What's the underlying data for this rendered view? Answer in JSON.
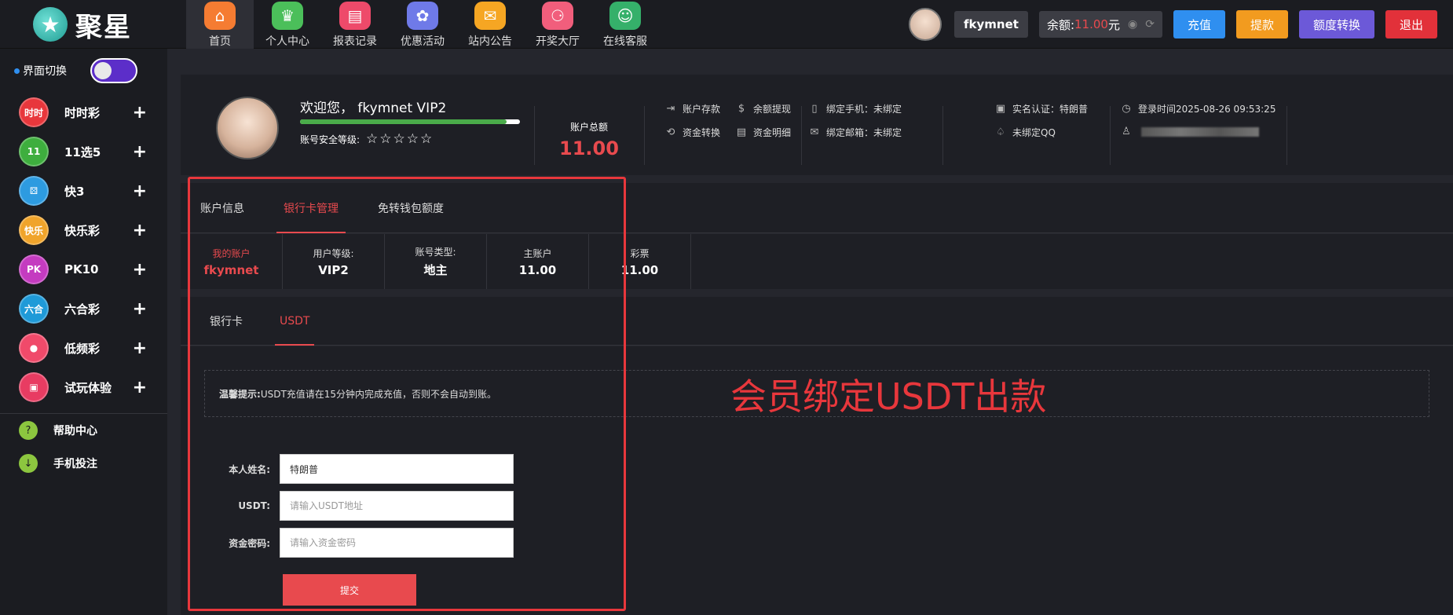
{
  "brand": {
    "name": "聚星",
    "logo_icon": "star-logo"
  },
  "nav": [
    {
      "label": "首页",
      "icon": "home-icon",
      "color": "#f57c32",
      "glyph": "⌂"
    },
    {
      "label": "个人中心",
      "icon": "crown-icon",
      "color": "#4bbf5a",
      "glyph": "♛"
    },
    {
      "label": "报表记录",
      "icon": "report-icon",
      "color": "#ee4a6a",
      "glyph": "▤"
    },
    {
      "label": "优惠活动",
      "icon": "gift-icon",
      "color": "#6f7ae8",
      "glyph": "✿"
    },
    {
      "label": "站内公告",
      "icon": "mail-icon",
      "color": "#f6a623",
      "glyph": "✉"
    },
    {
      "label": "开奖大厅",
      "icon": "lottery-icon",
      "color": "#f15e7c",
      "glyph": "⚆"
    },
    {
      "label": "在线客服",
      "icon": "support-icon",
      "color": "#35b06a",
      "glyph": "☺"
    }
  ],
  "topright": {
    "username": "fkymnet",
    "balance_label": "余额:",
    "balance_value": "11.00",
    "balance_unit": "元",
    "buttons": [
      "充值",
      "提款",
      "额度转换",
      "退出"
    ]
  },
  "sidebar": {
    "theme_label": "界面切换",
    "games": [
      {
        "label": "时时彩",
        "icon": "ssc-icon",
        "color": "#e8373c",
        "badge": "时时"
      },
      {
        "label": "11选5",
        "icon": "11x5-icon",
        "color": "#3eae3e",
        "badge": "11"
      },
      {
        "label": "快3",
        "icon": "k3-icon",
        "color": "#2d9be0",
        "badge": "⚄"
      },
      {
        "label": "快乐彩",
        "icon": "happy-icon",
        "color": "#f0a42b",
        "badge": "快乐"
      },
      {
        "label": "PK10",
        "icon": "pk10-icon",
        "color": "#c43bc0",
        "badge": "PK"
      },
      {
        "label": "六合彩",
        "icon": "lhc-icon",
        "color": "#1f9ad8",
        "badge": "六合"
      },
      {
        "label": "低频彩",
        "icon": "lowfreq-icon",
        "color": "#f04a6a",
        "badge": "●"
      },
      {
        "label": "试玩体验",
        "icon": "gamepad-icon",
        "color": "#e83c62",
        "badge": "▣"
      }
    ],
    "help": [
      {
        "label": "帮助中心",
        "icon": "help-icon",
        "glyph": "?"
      },
      {
        "label": "手机投注",
        "icon": "download-icon",
        "glyph": "↓"
      }
    ]
  },
  "profile": {
    "welcome": "欢迎您， fkymnet VIP2",
    "security_label": "账号安全等级:",
    "stars": "☆☆☆☆☆",
    "progress": 0.94,
    "total_label": "账户总额",
    "total_value": "11.00",
    "links": [
      {
        "label": "账户存款",
        "icon": "deposit-icon",
        "glyph": "⇥"
      },
      {
        "label": "余额提现",
        "icon": "moneybag-icon",
        "glyph": "$"
      },
      {
        "label": "资金转换",
        "icon": "transfer-icon",
        "glyph": "⟲"
      },
      {
        "label": "资金明细",
        "icon": "doc-icon",
        "glyph": "▤"
      }
    ],
    "binds": [
      {
        "label": "绑定手机：未绑定",
        "icon": "phone-icon",
        "glyph": "▯"
      },
      {
        "label": "绑定邮箱：未绑定",
        "icon": "email-icon",
        "glyph": "✉"
      },
      {
        "label": "实名认证：特朗普",
        "icon": "idcard-icon",
        "glyph": "▣"
      },
      {
        "label": "未绑定QQ",
        "icon": "qq-icon",
        "glyph": "♤"
      }
    ],
    "login_time": "登录时间2025-08-26 09:53:25"
  },
  "tabs": [
    "账户信息",
    "银行卡管理",
    "免转钱包额度"
  ],
  "info": [
    {
      "title": "我的账户",
      "value": "fkymnet"
    },
    {
      "title": "用户等级:",
      "value": "VIP2"
    },
    {
      "title": "账号类型:",
      "value": "地主"
    },
    {
      "title": "主账户",
      "value": "11.00"
    },
    {
      "title": "彩票",
      "value": "11.00"
    }
  ],
  "subtabs": [
    "银行卡",
    "USDT"
  ],
  "notice": {
    "bold": "温馨提示:",
    "text": " USDT充值请在15分钟内完成充值，否则不会自动到账。"
  },
  "annotation": "会员绑定USDT出款",
  "form": {
    "name_label": "本人姓名:",
    "name_value": "特朗普",
    "usdt_label": "USDT:",
    "usdt_placeholder": "请输入USDT地址",
    "pwd_label": "资金密码:",
    "pwd_placeholder": "请输入资金密码",
    "submit": "提交"
  }
}
